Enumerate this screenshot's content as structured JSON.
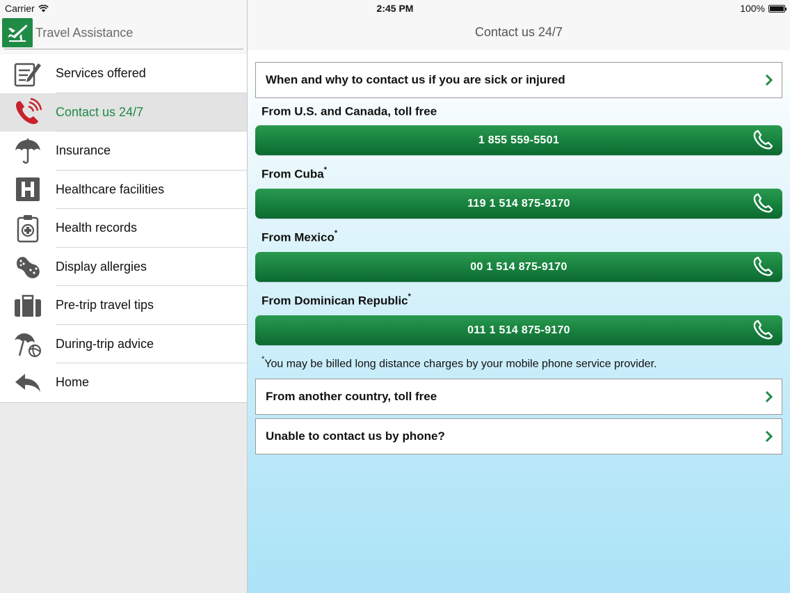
{
  "status_bar": {
    "carrier": "Carrier",
    "time": "2:45 PM",
    "battery": "100%",
    "battery_level": 1.0
  },
  "app": {
    "title": "Travel Assistance",
    "logo_icon": "airplane-icon",
    "brand_color": "#1f8b45"
  },
  "menu": {
    "items": [
      {
        "label": "Services offered",
        "icon": "clipboard-pen-icon",
        "active": false
      },
      {
        "label": "Contact us 24/7",
        "icon": "phone-icon",
        "active": true
      },
      {
        "label": "Insurance",
        "icon": "umbrella-icon",
        "active": false
      },
      {
        "label": "Healthcare facilities",
        "icon": "hospital-icon",
        "active": false
      },
      {
        "label": "Health records",
        "icon": "medical-clipboard-icon",
        "active": false
      },
      {
        "label": "Display allergies",
        "icon": "peanut-icon",
        "active": false
      },
      {
        "label": "Pre-trip travel tips",
        "icon": "suitcase-icon",
        "active": false
      },
      {
        "label": "During-trip advice",
        "icon": "beach-umbrella-icon",
        "active": false
      },
      {
        "label": "Home",
        "icon": "back-arrow-icon",
        "active": false
      }
    ]
  },
  "main": {
    "nav_title": "Contact us 24/7",
    "sick_link": "When and why to contact us if you are sick or injured",
    "contacts": [
      {
        "label": "From U.S. and Canada, toll free",
        "asterisk": "",
        "number": "1 855 559-5501"
      },
      {
        "label": "From Cuba",
        "asterisk": "*",
        "number": "119 1 514 875-9170"
      },
      {
        "label": "From Mexico",
        "asterisk": "*",
        "number": "00 1 514 875-9170"
      },
      {
        "label": "From Dominican Republic",
        "asterisk": "*",
        "number": "011 1 514 875-9170"
      }
    ],
    "footnote_mark": "*",
    "footnote": "You may be billed long distance charges by your mobile phone service provider.",
    "other_country_link": "From another country, toll free",
    "unable_link": "Unable to contact us by phone?"
  }
}
